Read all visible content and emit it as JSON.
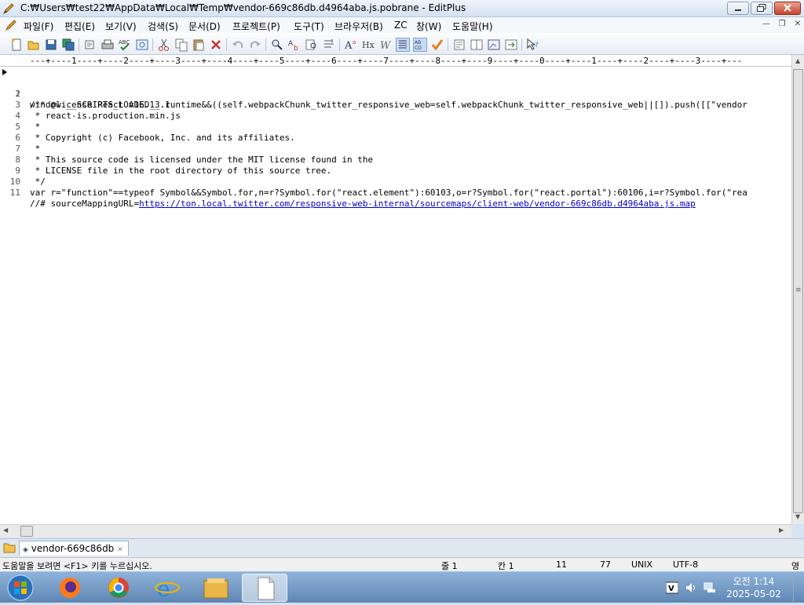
{
  "window": {
    "title": "C:₩Users₩test22₩AppData₩Local₩Temp₩vendor-669c86db.d4964aba.js.pobrane - EditPlus"
  },
  "menu": [
    "파일(F)",
    "편집(E)",
    "보기(V)",
    "검색(S)",
    "문서(D)",
    "프로젝트(P)",
    "도구(T)",
    "브라우저(B)",
    "ZC",
    "창(W)",
    "도움말(H)"
  ],
  "ruler": "---+----1----+----2----+----3----+----4----+----5----+----6----+----7----+----8----+----9----+----0----+----1----+----2----+----3----+---",
  "editor": {
    "lines": [
      {
        "num": "1",
        "text": "window.__SCRIPTS_LOADED__.runtime&&((self.webpackChunk_twitter_responsive_web=self.webpackChunk_twitter_responsive_web||[]).push([[\"vendor"
      },
      {
        "num": "2",
        "text": "/** @license React v16.13.1"
      },
      {
        "num": "3",
        "text": " * react-is.production.min.js"
      },
      {
        "num": "4",
        "text": " *"
      },
      {
        "num": "5",
        "text": " * Copyright (c) Facebook, Inc. and its affiliates."
      },
      {
        "num": "6",
        "text": " *"
      },
      {
        "num": "7",
        "text": " * This source code is licensed under the MIT license found in the"
      },
      {
        "num": "8",
        "text": " * LICENSE file in the root directory of this source tree."
      },
      {
        "num": "9",
        "text": " */"
      },
      {
        "num": "10",
        "text": "var r=\"function\"==typeof Symbol&&Symbol.for,n=r?Symbol.for(\"react.element\"):60103,o=r?Symbol.for(\"react.portal\"):60106,i=r?Symbol.for(\"rea"
      },
      {
        "num": "11",
        "prefix": "//# sourceMappingURL=",
        "link": "https://ton.local.twitter.com/responsive-web-internal/sourcemaps/client-web/vendor-669c86db.d4964aba.js.map"
      }
    ]
  },
  "doc_tab": {
    "label": "vendor-669c86db"
  },
  "status": {
    "help": "도움말을 보려면 <F1> 키를 누르십시오.",
    "line": "줄 1",
    "col": "칸 1",
    "total_lines": "11",
    "chars": "77",
    "eol": "UNIX",
    "encoding": "UTF-8",
    "ime": "영"
  },
  "taskbar": {
    "time": "오전 1:14",
    "date": "2025-05-02"
  }
}
